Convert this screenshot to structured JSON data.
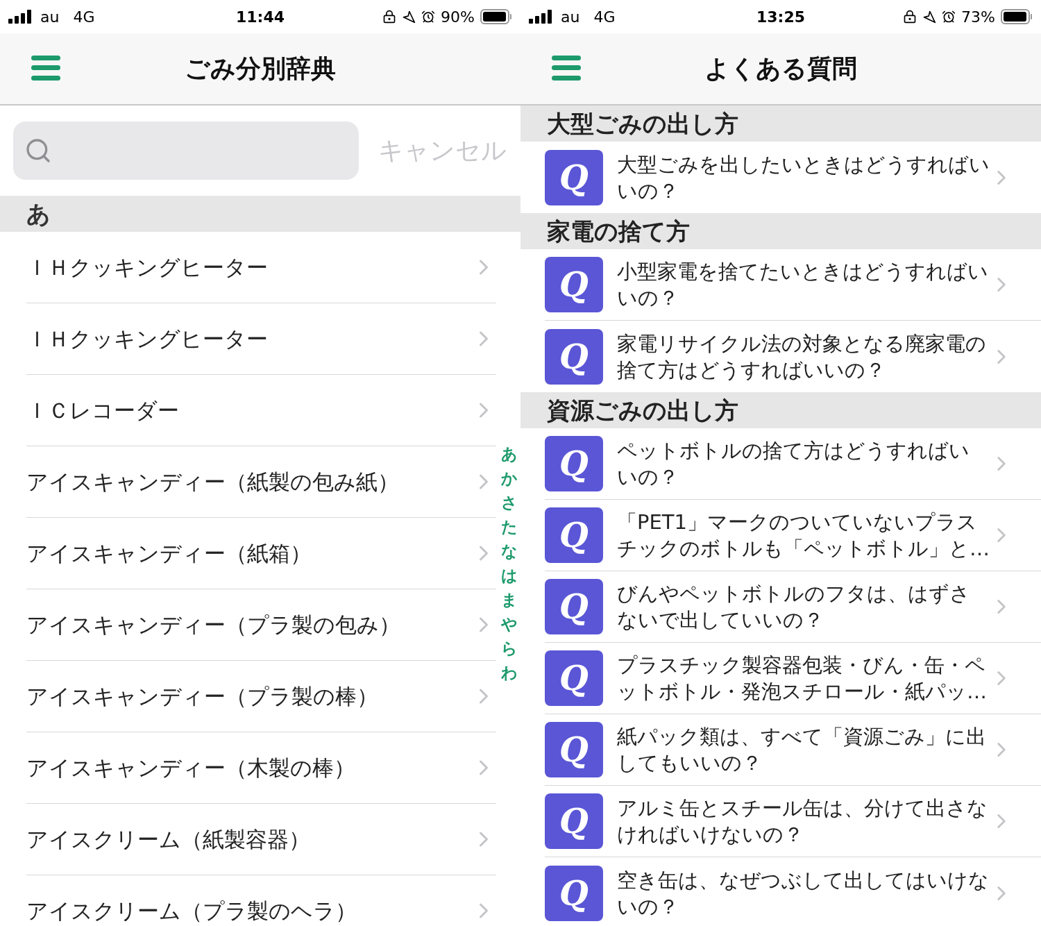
{
  "screens": [
    {
      "kind": "dictionary",
      "status_bar": {
        "carrier": "au",
        "network": "4G",
        "time": "11:44",
        "battery": "90%"
      },
      "header": {
        "title": "ごみ分別辞典"
      },
      "search": {
        "cancel": "キャンセル"
      },
      "section": "あ",
      "items": [
        "ＩＨクッキングヒーター",
        "ＩＨクッキングヒーター",
        "ＩＣレコーダー",
        "アイスキャンディー（紙製の包み紙）",
        "アイスキャンディー（紙箱）",
        "アイスキャンディー（プラ製の包み）",
        "アイスキャンディー（プラ製の棒）",
        "アイスキャンディー（木製の棒）",
        "アイスクリーム（紙製容器）",
        "アイスクリーム（プラ製のヘラ）"
      ],
      "index": [
        "あ",
        "か",
        "さ",
        "た",
        "な",
        "は",
        "ま",
        "や",
        "ら",
        "わ"
      ]
    },
    {
      "kind": "faq",
      "status_bar": {
        "carrier": "au",
        "network": "4G",
        "time": "13:25",
        "battery": "73%"
      },
      "header": {
        "title": "よくある質問"
      },
      "sections": [
        {
          "title": "大型ごみの出し方",
          "questions": [
            {
              "badge": "Q",
              "text": "大型ごみを出したいときはどうすればいいの？"
            }
          ]
        },
        {
          "title": "家電の捨て方",
          "questions": [
            {
              "badge": "Q",
              "text": "小型家電を捨てたいときはどうすればいいの？"
            },
            {
              "badge": "Q",
              "text": "家電リサイクル法の対象となる廃家電の捨て方はどうすればいいの？"
            }
          ]
        },
        {
          "title": "資源ごみの出し方",
          "questions": [
            {
              "badge": "Q",
              "text": "ペットボトルの捨て方はどうすればいいの？"
            },
            {
              "badge": "Q",
              "text": "「PET1」マークのついていないプラスチックのボトルも「ペットボトル」と…"
            },
            {
              "badge": "Q",
              "text": "びんやペットボトルのフタは、はずさないで出していいの？"
            },
            {
              "badge": "Q",
              "text": "プラスチック製容器包装・びん・缶・ペットボトル・発泡スチロール・紙パッ…"
            },
            {
              "badge": "Q",
              "text": "紙パック類は、すべて「資源ごみ」に出してもいいの？"
            },
            {
              "badge": "Q",
              "text": "アルミ缶とスチール缶は、分けて出さなければいけないの？"
            },
            {
              "badge": "Q",
              "text": "空き缶は、なぜつぶして出してはいけないの？"
            }
          ]
        }
      ]
    }
  ]
}
